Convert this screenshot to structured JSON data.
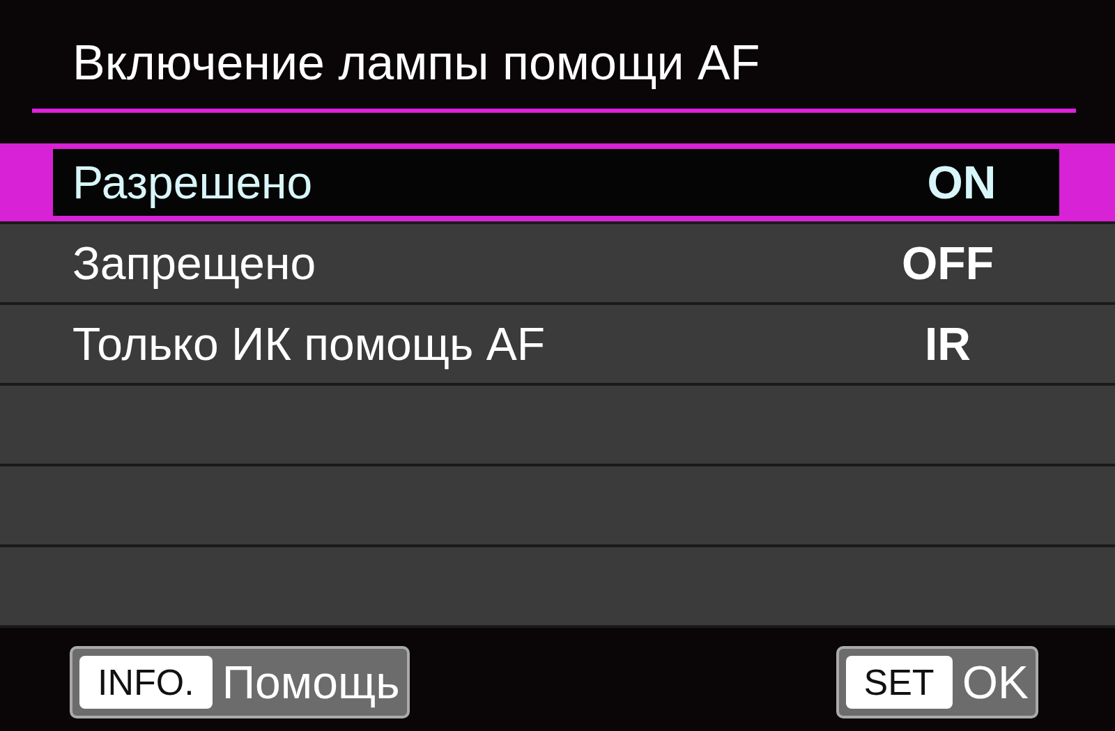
{
  "title": "Включение лампы помощи AF",
  "options": [
    {
      "label": "Разрешено",
      "value": "ON",
      "selected": true
    },
    {
      "label": "Запрещено",
      "value": "OFF",
      "selected": false
    },
    {
      "label": "Только ИК помощь AF",
      "value": "IR",
      "selected": false
    }
  ],
  "buttons": [
    {
      "key": "INFO.",
      "label": "Помощь"
    },
    {
      "key": "SET",
      "label": "OK"
    }
  ]
}
